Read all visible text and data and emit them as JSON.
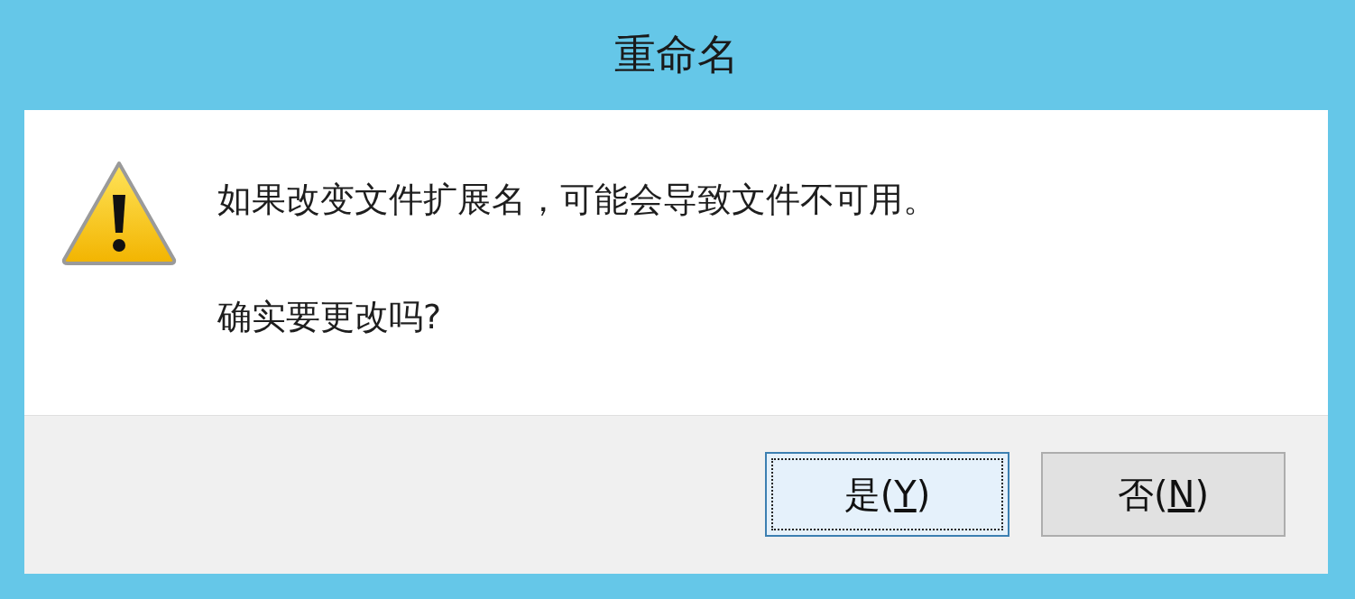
{
  "window": {
    "title": "重命名"
  },
  "message": {
    "lines": [
      "如果改变文件扩展名，可能会导致文件不可用。",
      "确实要更改吗?"
    ]
  },
  "buttons": [
    {
      "before": "是(",
      "mnemonic": "Y",
      "after": ")",
      "default": true
    },
    {
      "before": "否(",
      "mnemonic": "N",
      "after": ")",
      "default": false
    }
  ]
}
